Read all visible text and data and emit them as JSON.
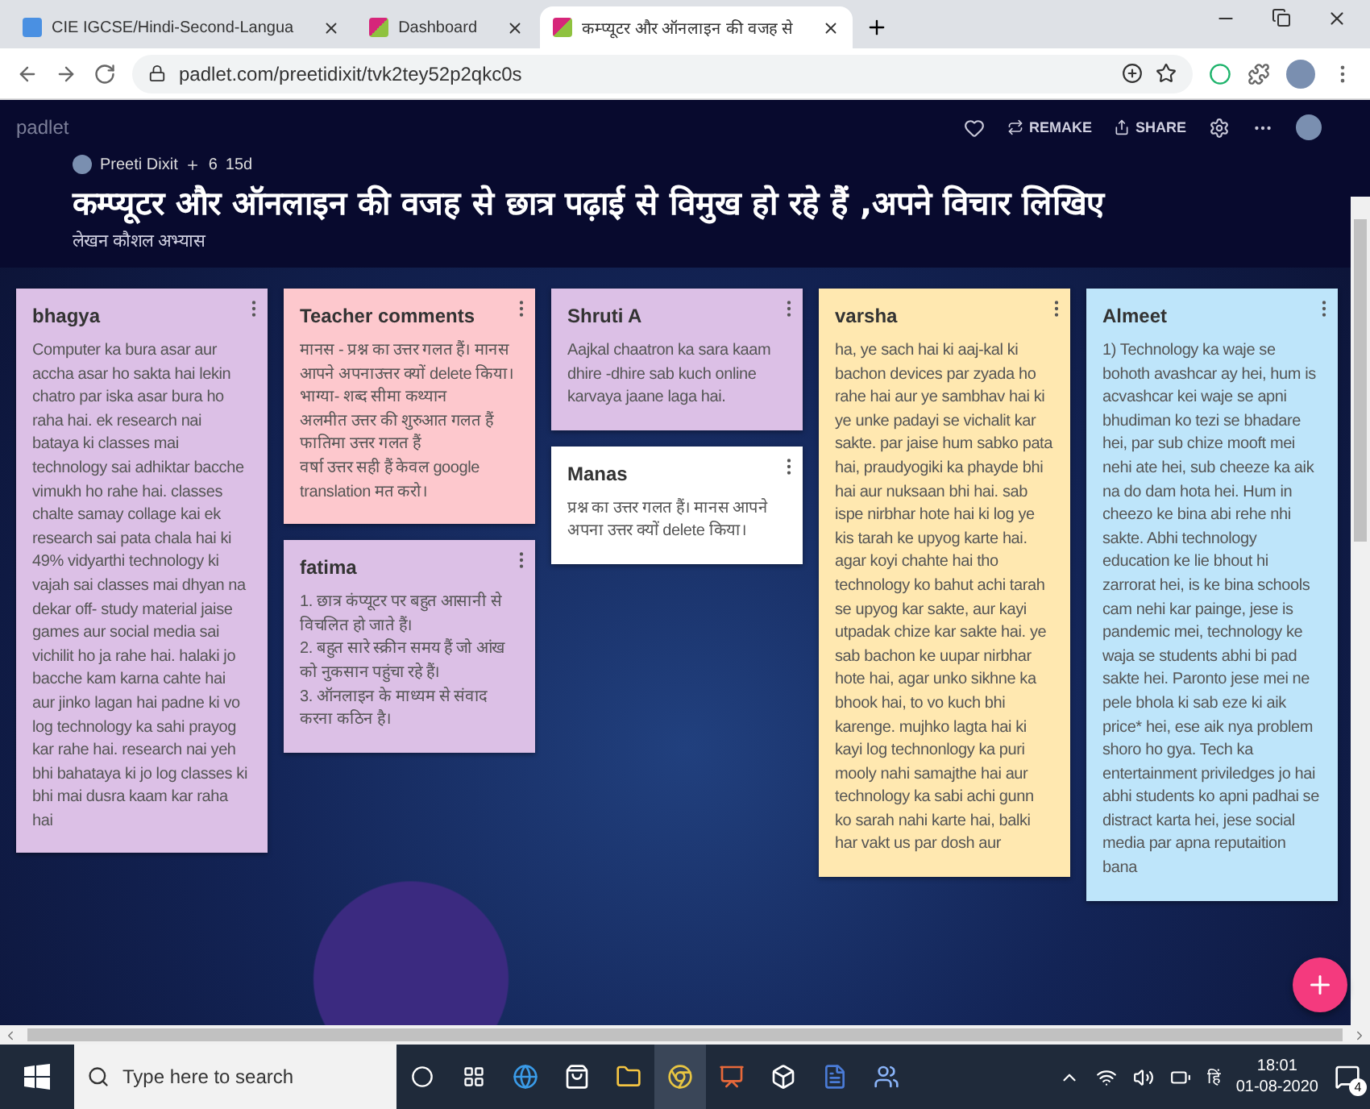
{
  "browser": {
    "tabs": [
      {
        "title": "CIE IGCSE/Hindi-Second-Langua",
        "kind": "doc",
        "selected": false
      },
      {
        "title": "Dashboard",
        "kind": "padlet",
        "selected": false
      },
      {
        "title": "कम्प्यूटर और ऑनलाइन की वजह से",
        "kind": "padlet",
        "selected": true
      }
    ],
    "url": "padlet.com/preetidixit/tvk2tey52p2qkc0s"
  },
  "padlet": {
    "logo": "padlet",
    "actions": [
      "REMAKE",
      "SHARE"
    ],
    "author": "Preeti Dixit",
    "likes": "6",
    "age": "15d",
    "title": "कम्प्यूटर और ऑनलाइन की वजह से छात्र पढ़ाई से विमुख हो रहे हैं ,अपने विचार लिखिए",
    "subtitle": "लेखन कौशल अभ्यास"
  },
  "columns": [
    {
      "cards": [
        {
          "author": "bhagya",
          "color": "#dcc0e6",
          "text": "Computer ka bura asar aur accha asar ho sakta hai lekin chatro par iska asar bura ho raha hai. ek research nai bataya ki classes mai technology sai adhiktar bacche vimukh ho rahe hai.  classes chalte samay collage  kai ek research sai pata chala hai ki 49% vidyarthi technology ki vajah sai classes mai dhyan na dekar off- study material jaise games aur social media sai vichilit ho ja rahe hai. halaki jo bacche kam karna cahte hai aur jinko lagan hai padne ki vo log technology ka sahi prayog kar rahe hai. research nai yeh bhi bahataya ki jo log classes ki bhi mai dusra kaam kar raha hai"
        }
      ]
    },
    {
      "cards": [
        {
          "author": "Teacher comments",
          "color": "#fdc8cd",
          "lines": [
            "मानस - प्रश्न का उत्तर गलत हैं। मानस आपने अपनाउत्तर क्यों delete किया।",
            "भाग्या- शब्द सीमा कथ्यान",
            "अलमीत उत्तर की शुरुआत गलत हैं",
            "फातिमा उत्तर गलत हैं",
            "वर्षा उत्तर सही हैं केवल google translation मत करो।"
          ]
        },
        {
          "author": "fatima",
          "color": "#dcc0e6",
          "lines": [
            "1. छात्र कंप्यूटर पर बहुत आसानी से विचलित हो जाते हैं।",
            "2. बहुत सारे स्क्रीन समय हैं जो आंख को नुकसान पहुंचा रहे हैं।",
            "3. ऑनलाइन के माध्यम से संवाद करना कठिन है।"
          ]
        }
      ]
    },
    {
      "cards": [
        {
          "author": "Shruti A",
          "color": "#dcc0e6",
          "text": "Aajkal chaatron ka sara kaam dhire -dhire sab kuch online karvaya jaane laga hai."
        },
        {
          "author": "Manas",
          "color": "#ffffff",
          "text": "प्रश्न का उत्तर गलत हैं। मानस आपने अपना उत्तर क्यों delete किया।"
        }
      ]
    },
    {
      "cards": [
        {
          "author": "varsha",
          "color": "#ffe8b0",
          "text": "ha, ye sach hai ki aaj-kal ki bachon devices par zyada ho rahe hai aur ye sambhav hai ki ye unke padayi se vichalit kar sakte. par jaise hum sabko pata hai, praudyogiki ka phayde bhi hai aur nuksaan bhi hai. sab ispe nirbhar hote hai ki log ye kis tarah ke upyog karte hai. agar koyi chahte hai tho technology ko bahut achi tarah se upyog kar sakte, aur kayi utpadak chize kar sakte hai. ye sab bachon ke uupar nirbhar hote hai, agar unko sikhne ka bhook hai, to vo kuch bhi karenge. mujhko lagta hai ki kayi log technonlogy ka puri mooly nahi samajthe hai aur technology ka sabi achi gunn ko sarah nahi karte hai, balki har vakt us par dosh aur"
        }
      ]
    },
    {
      "cards": [
        {
          "author": "Almeet",
          "color": "#bee5fa",
          "text": "1) Technology ka waje se bohoth avashcar ay hei, hum is acvashcar kei waje se apni bhudiman ko tezi se bhadare hei, par sub chize mooft mei nehi ate hei, sub cheeze ka aik na do dam hota hei. Hum in cheezo ke bina abi rehe nhi sakte. Abhi technology education ke lie bhout hi zarrorat hei, is ke bina schools cam nehi kar painge, jese is pandemic mei, technology ke waja se students abhi bi pad sakte hei. Paronto jese mei ne pele bhola ki sab eze ki aik price* hei, ese aik nya problem shoro ho gya. Tech ka entertainment priviledges jo hai abhi students ko apni padhai se distract karta hei, jese social media par apna reputaition bana"
        }
      ]
    }
  ],
  "taskbar": {
    "search_placeholder": "Type here to search",
    "language": "हिं",
    "time": "18:01",
    "date": "01-08-2020",
    "notifications": "4"
  }
}
